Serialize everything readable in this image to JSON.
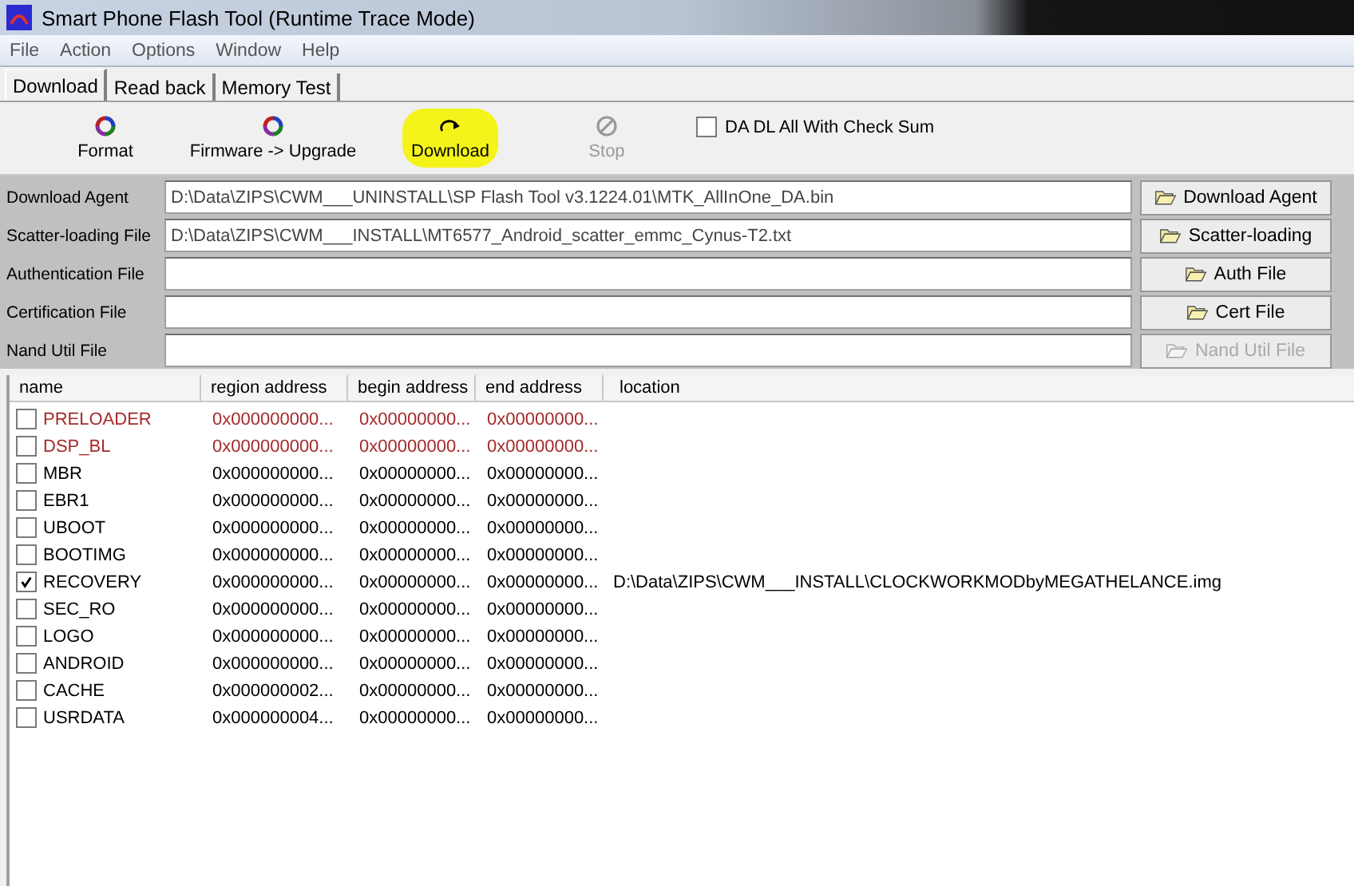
{
  "window": {
    "title": "Smart Phone Flash Tool (Runtime Trace Mode)"
  },
  "menu": [
    "File",
    "Action",
    "Options",
    "Window",
    "Help"
  ],
  "tabs": [
    {
      "label": "Download",
      "selected": true
    },
    {
      "label": "Read back",
      "selected": false
    },
    {
      "label": "Memory Test",
      "selected": false
    }
  ],
  "toolbar": [
    {
      "label": "Format",
      "kind": "format",
      "disabled": false,
      "highlighted": false
    },
    {
      "label": "Firmware -> Upgrade",
      "kind": "format",
      "disabled": false,
      "highlighted": false
    },
    {
      "label": "Download",
      "kind": "download",
      "disabled": false,
      "highlighted": true
    },
    {
      "label": "Stop",
      "kind": "stop",
      "disabled": true,
      "highlighted": false
    }
  ],
  "checksum": {
    "label": "DA DL All With Check Sum",
    "checked": false
  },
  "files": [
    {
      "label": "Download Agent",
      "value": "D:\\Data\\ZIPS\\CWM___UNINSTALL\\SP Flash Tool v3.1224.01\\MTK_AllInOne_DA.bin",
      "button": "Download Agent",
      "disabled": false
    },
    {
      "label": "Scatter-loading File",
      "value": "D:\\Data\\ZIPS\\CWM___INSTALL\\MT6577_Android_scatter_emmc_Cynus-T2.txt",
      "button": "Scatter-loading",
      "disabled": false
    },
    {
      "label": "Authentication File",
      "button": "Auth File",
      "disabled": false
    },
    {
      "label": "Certification File",
      "button": "Cert File",
      "disabled": false
    },
    {
      "label": "Nand Util File",
      "button": "Nand Util File",
      "disabled": true
    }
  ],
  "table": {
    "columns": [
      "name",
      "region address",
      "begin address",
      "end address",
      "location"
    ],
    "rows": [
      {
        "name": "PRELOADER",
        "region": "0x000000000...",
        "begin": "0x00000000...",
        "end": "0x00000000...",
        "checked": false,
        "color": "#a52a2a"
      },
      {
        "name": "DSP_BL",
        "region": "0x000000000...",
        "begin": "0x00000000...",
        "end": "0x00000000...",
        "checked": false,
        "color": "#a52a2a"
      },
      {
        "name": "MBR",
        "region": "0x000000000...",
        "begin": "0x00000000...",
        "end": "0x00000000...",
        "checked": false,
        "color": "#000000"
      },
      {
        "name": "EBR1",
        "region": "0x000000000...",
        "begin": "0x00000000...",
        "end": "0x00000000...",
        "checked": false,
        "color": "#000000"
      },
      {
        "name": "UBOOT",
        "region": "0x000000000...",
        "begin": "0x00000000...",
        "end": "0x00000000...",
        "checked": false,
        "color": "#000000"
      },
      {
        "name": "BOOTIMG",
        "region": "0x000000000...",
        "begin": "0x00000000...",
        "end": "0x00000000...",
        "checked": false,
        "color": "#000000"
      },
      {
        "name": "RECOVERY",
        "region": "0x000000000...",
        "begin": "0x00000000...",
        "end": "0x00000000...",
        "location": "D:\\Data\\ZIPS\\CWM___INSTALL\\CLOCKWORKMODbyMEGATHELANCE.img",
        "checked": true,
        "color": "#000000"
      },
      {
        "name": "SEC_RO",
        "region": "0x000000000...",
        "begin": "0x00000000...",
        "end": "0x00000000...",
        "checked": false,
        "color": "#000000"
      },
      {
        "name": "LOGO",
        "region": "0x000000000...",
        "begin": "0x00000000...",
        "end": "0x00000000...",
        "checked": false,
        "color": "#000000"
      },
      {
        "name": "ANDROID",
        "region": "0x000000000...",
        "begin": "0x00000000...",
        "end": "0x00000000...",
        "checked": false,
        "color": "#000000"
      },
      {
        "name": "CACHE",
        "region": "0x000000002...",
        "begin": "0x00000000...",
        "end": "0x00000000...",
        "checked": false,
        "color": "#000000"
      },
      {
        "name": "USRDATA",
        "region": "0x000000004...",
        "begin": "0x00000000...",
        "end": "0x00000000...",
        "checked": false,
        "color": "#000000"
      }
    ]
  }
}
